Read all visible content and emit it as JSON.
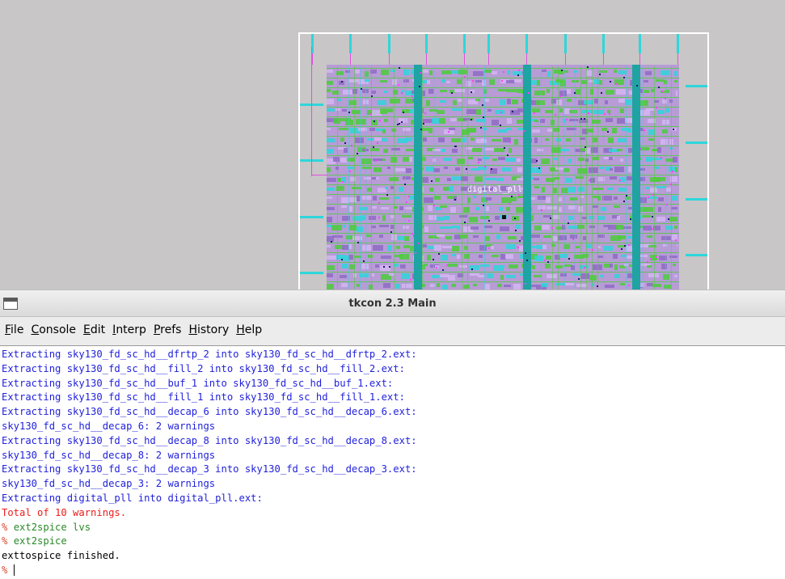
{
  "layout_view": {
    "cell_label": "digital_pll",
    "colors": {
      "background": "#c8c6c6",
      "boundary": "#ffffff",
      "cell_fill": "#b79cd6",
      "metal_green": "#4ccd3a",
      "metal_cyan": "#2ed6db",
      "power_strap": "#1fa3a3",
      "pin_magenta": "#e050e0"
    }
  },
  "window": {
    "title": "tkcon 2.3 Main",
    "icon": "window-icon"
  },
  "menu": [
    {
      "pre": "",
      "key": "F",
      "rest": "ile"
    },
    {
      "pre": "",
      "key": "C",
      "rest": "onsole"
    },
    {
      "pre": "",
      "key": "E",
      "rest": "dit"
    },
    {
      "pre": "",
      "key": "I",
      "rest": "nterp"
    },
    {
      "pre": "",
      "key": "P",
      "rest": "refs"
    },
    {
      "pre": "",
      "key": "H",
      "rest": "istory"
    },
    {
      "pre": "",
      "key": "H",
      "rest": "elp"
    }
  ],
  "console": {
    "lines": [
      {
        "type": "blue",
        "text": "Extracting sky130_fd_sc_hd__dfrtp_2 into sky130_fd_sc_hd__dfrtp_2.ext:"
      },
      {
        "type": "blue",
        "text": "Extracting sky130_fd_sc_hd__fill_2 into sky130_fd_sc_hd__fill_2.ext:"
      },
      {
        "type": "blue",
        "text": "Extracting sky130_fd_sc_hd__buf_1 into sky130_fd_sc_hd__buf_1.ext:"
      },
      {
        "type": "blue",
        "text": "Extracting sky130_fd_sc_hd__fill_1 into sky130_fd_sc_hd__fill_1.ext:"
      },
      {
        "type": "blue",
        "text": "Extracting sky130_fd_sc_hd__decap_6 into sky130_fd_sc_hd__decap_6.ext:"
      },
      {
        "type": "blue",
        "text": "sky130_fd_sc_hd__decap_6: 2 warnings"
      },
      {
        "type": "blue",
        "text": "Extracting sky130_fd_sc_hd__decap_8 into sky130_fd_sc_hd__decap_8.ext:"
      },
      {
        "type": "blue",
        "text": "sky130_fd_sc_hd__decap_8: 2 warnings"
      },
      {
        "type": "blue",
        "text": "Extracting sky130_fd_sc_hd__decap_3 into sky130_fd_sc_hd__decap_3.ext:"
      },
      {
        "type": "blue",
        "text": "sky130_fd_sc_hd__decap_3: 2 warnings"
      },
      {
        "type": "blue",
        "text": "Extracting digital_pll into digital_pll.ext:"
      },
      {
        "type": "red",
        "text": "Total of 10 warnings."
      },
      {
        "type": "cmd",
        "prompt": "% ",
        "text": "ext2spice lvs"
      },
      {
        "type": "cmd",
        "prompt": "% ",
        "text": "ext2spice"
      },
      {
        "type": "black",
        "text": "exttospice finished."
      },
      {
        "type": "input",
        "prompt": "% ",
        "text": ""
      }
    ]
  }
}
